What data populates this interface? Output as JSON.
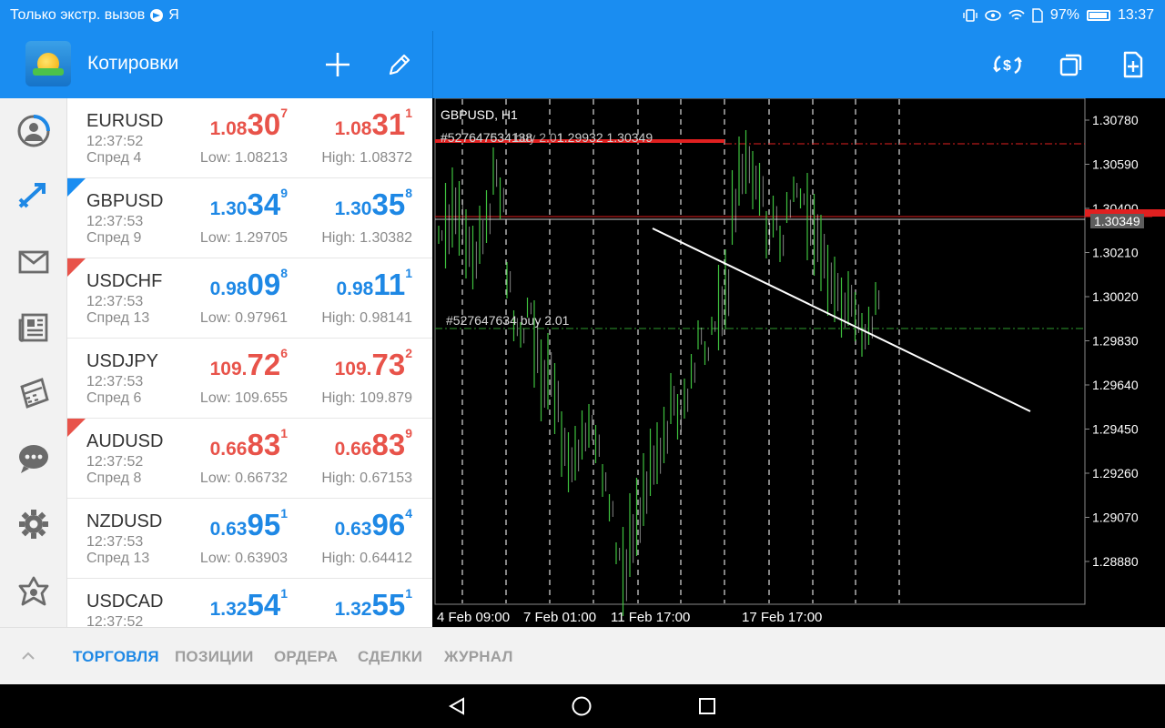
{
  "status_bar": {
    "left_text": "Только экстр. вызов",
    "letter": "Я",
    "battery": "97%",
    "time": "13:37"
  },
  "app_bar": {
    "title": "Котировки",
    "icons": [
      "logo-icon",
      "plus-icon",
      "pencil-icon",
      "currency-exchange-icon",
      "windows-icon",
      "new-document-icon"
    ]
  },
  "sidebar": {
    "items": [
      "account-icon",
      "trade-icon",
      "mail-icon",
      "news-icon",
      "economic-calendar-icon",
      "chat-icon",
      "settings-icon",
      "community-icon"
    ]
  },
  "quotes": [
    {
      "symbol": "EURUSD",
      "time": "12:37:52",
      "spread": "Спред 4",
      "bid_a": "1.08",
      "bid_b": "30",
      "bid_c": "7",
      "ask_a": "1.08",
      "ask_b": "31",
      "ask_c": "1",
      "low": "Low: 1.08213",
      "high": "High: 1.08372",
      "bid_color": "#e8534a",
      "ask_color": "#e8534a",
      "corner": ""
    },
    {
      "symbol": "GBPUSD",
      "time": "12:37:53",
      "spread": "Спред 9",
      "bid_a": "1.30",
      "bid_b": "34",
      "bid_c": "9",
      "ask_a": "1.30",
      "ask_b": "35",
      "ask_c": "8",
      "low": "Low: 1.29705",
      "high": "High: 1.30382",
      "bid_color": "#1e88e5",
      "ask_color": "#1e88e5",
      "corner": "blue"
    },
    {
      "symbol": "USDCHF",
      "time": "12:37:53",
      "spread": "Спред 13",
      "bid_a": "0.98",
      "bid_b": "09",
      "bid_c": "8",
      "ask_a": "0.98",
      "ask_b": "11",
      "ask_c": "1",
      "low": "Low: 0.97961",
      "high": "High: 0.98141",
      "bid_color": "#1e88e5",
      "ask_color": "#1e88e5",
      "corner": "red"
    },
    {
      "symbol": "USDJPY",
      "time": "12:37:53",
      "spread": "Спред 6",
      "bid_a": "109.",
      "bid_b": "72",
      "bid_c": "6",
      "ask_a": "109.",
      "ask_b": "73",
      "ask_c": "2",
      "low": "Low: 109.655",
      "high": "High: 109.879",
      "bid_color": "#e8534a",
      "ask_color": "#e8534a",
      "corner": ""
    },
    {
      "symbol": "AUDUSD",
      "time": "12:37:52",
      "spread": "Спред 8",
      "bid_a": "0.66",
      "bid_b": "83",
      "bid_c": "1",
      "ask_a": "0.66",
      "ask_b": "83",
      "ask_c": "9",
      "low": "Low: 0.66732",
      "high": "High: 0.67153",
      "bid_color": "#e8534a",
      "ask_color": "#e8534a",
      "corner": "red"
    },
    {
      "symbol": "NZDUSD",
      "time": "12:37:53",
      "spread": "Спред 13",
      "bid_a": "0.63",
      "bid_b": "95",
      "bid_c": "1",
      "ask_a": "0.63",
      "ask_b": "96",
      "ask_c": "4",
      "low": "Low: 0.63903",
      "high": "High: 0.64412",
      "bid_color": "#1e88e5",
      "ask_color": "#1e88e5",
      "corner": ""
    },
    {
      "symbol": "USDCAD",
      "time": "12:37:52",
      "spread": "",
      "bid_a": "1.32",
      "bid_b": "54",
      "bid_c": "1",
      "ask_a": "1.32",
      "ask_b": "55",
      "ask_c": "1",
      "low": "",
      "high": "",
      "bid_color": "#1e88e5",
      "ask_color": "#1e88e5",
      "corner": ""
    }
  ],
  "chart": {
    "title": "GBPUSD, H1",
    "order_label_top": "#527647534138",
    "order_label_top2": "#527647634 buy 2.01",
    "top_text": "1.29932 1.30349",
    "buy_label": "#527647634 buy 2.01",
    "current_price": "1.30349",
    "y_ticks": [
      "1.30780",
      "1.30590",
      "1.30400",
      "1.30210",
      "1.30020",
      "1.29830",
      "1.29640",
      "1.29450",
      "1.29260",
      "1.29070",
      "1.28880"
    ],
    "x_ticks": [
      "4 Feb 09:00",
      "7 Feb 01:00",
      "11 Feb 17:00",
      "17 Feb 17:00"
    ],
    "colors": {
      "candle": "#3ec13e",
      "sl_line": "#e02020",
      "price_line": "#ffffff",
      "buy_line": "#2e9a2e"
    }
  },
  "tabs": {
    "items": [
      "ТОРГОВЛЯ",
      "ПОЗИЦИИ",
      "ОРДЕРА",
      "СДЕЛКИ",
      "ЖУРНАЛ"
    ],
    "active": "ТОРГОВЛЯ"
  }
}
